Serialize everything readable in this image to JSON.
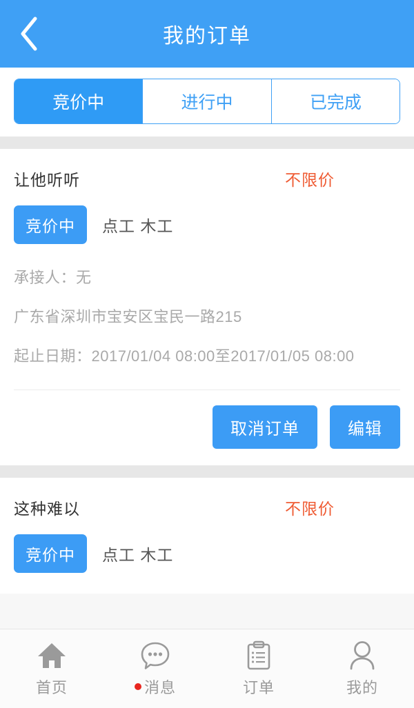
{
  "header": {
    "title": "我的订单",
    "back_icon": "chevron-left-icon"
  },
  "tabs": {
    "items": [
      {
        "label": "竞价中",
        "active": true
      },
      {
        "label": "进行中",
        "active": false
      },
      {
        "label": "已完成",
        "active": false
      }
    ]
  },
  "orders": [
    {
      "title": "让他听听",
      "price": "不限价",
      "status": "竞价中",
      "tags": "点工  木工",
      "contractor": "承接人：无",
      "address": "广东省深圳市宝安区宝民一路215",
      "date_range": "起止日期：2017/01/04 08:00至2017/01/05 08:00",
      "cancel_label": "取消订单",
      "edit_label": "编辑"
    },
    {
      "title": "这种难以",
      "price": "不限价",
      "status": "竞价中",
      "tags": "点工  木工"
    }
  ],
  "bottom_nav": {
    "items": [
      {
        "label": "首页",
        "icon": "home-icon",
        "badge": false
      },
      {
        "label": "消息",
        "icon": "chat-bubble-icon",
        "badge": true
      },
      {
        "label": "订单",
        "icon": "clipboard-icon",
        "badge": false
      },
      {
        "label": "我的",
        "icon": "person-icon",
        "badge": false
      }
    ]
  },
  "colors": {
    "header_blue": "#3fa0f5",
    "accent_blue": "#3c9cf5",
    "price_orange": "#ef5b33",
    "badge_red": "#e8261f"
  }
}
